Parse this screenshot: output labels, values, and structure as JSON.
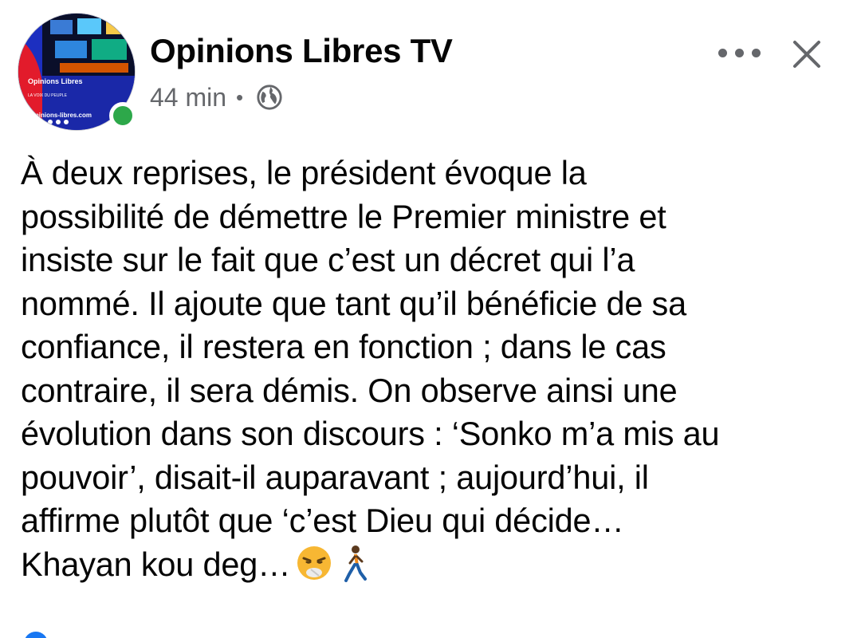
{
  "post": {
    "page_name": "Opinions Libres TV",
    "timestamp": "44 min",
    "separator": "•",
    "privacy_icon": "globe-icon",
    "avatar": {
      "brand_text": "Opinions Libres",
      "tagline": "LA VOIX DU PEUPLE",
      "url": "opinions-libres.com"
    },
    "actions": {
      "more_icon": "more-horizontal-icon",
      "close_icon": "close-icon"
    },
    "text_lines": [
      "À deux reprises, le président évoque la",
      "possibilité de démettre le Premier ministre et",
      "insiste sur le fait que c’est un décret qui l’a",
      "nommé. Il ajoute que tant qu’il bénéficie de sa",
      "confiance, il restera en fonction ; dans le cas",
      "contraire, il sera démis. On observe ainsi une",
      "évolution dans son discours : ‘Sonko m’a mis au",
      "pouvoir’, disait-il auparavant ; aujourd’hui, il",
      "affirme plutôt que ‘c’est Dieu qui décide…",
      "Khayan kou deg…"
    ],
    "trailing_emojis": [
      "sneezing-face-emoji",
      "person-walking-emoji"
    ],
    "colors": {
      "text": "#050505",
      "secondary": "#65676b",
      "online": "#2da84a",
      "accent": "#1877f2"
    }
  }
}
